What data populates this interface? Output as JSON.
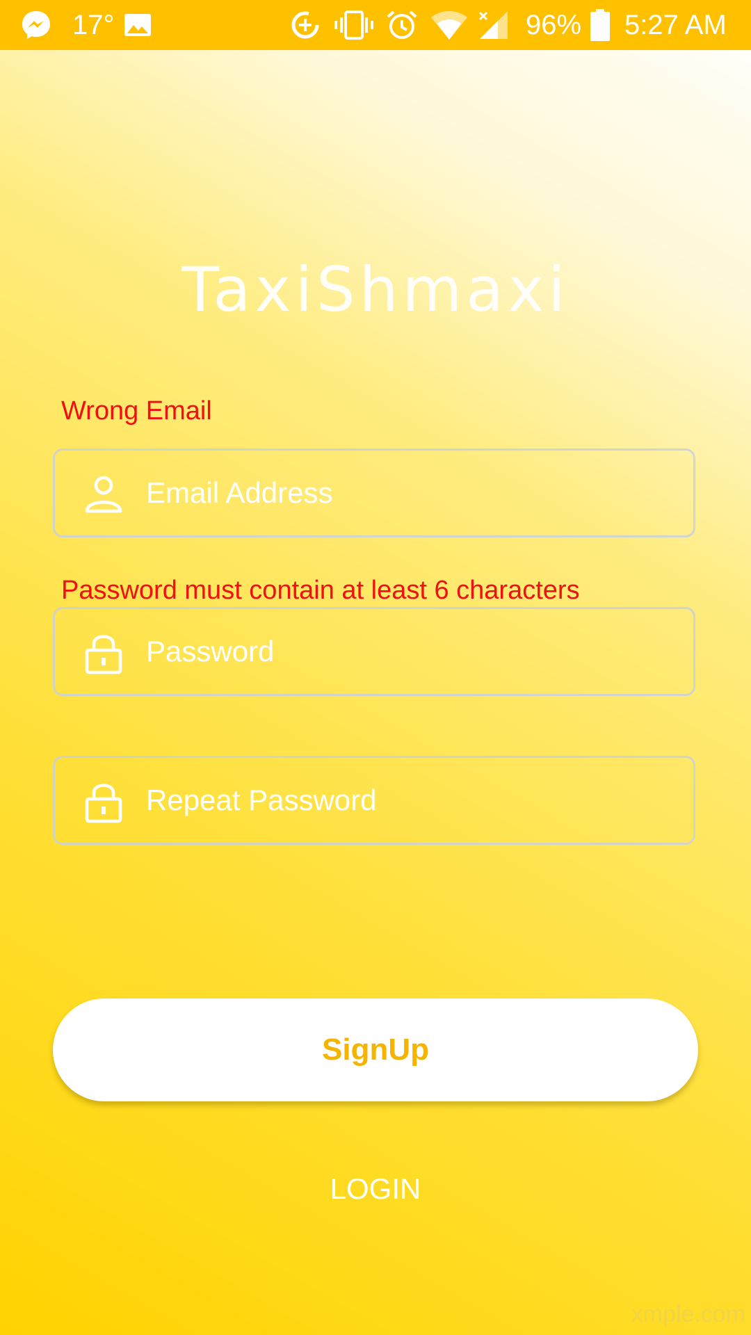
{
  "status_bar": {
    "temperature": "17°",
    "battery": "96%",
    "time": "5:27 AM",
    "icons": [
      "messenger-icon",
      "image-icon",
      "data-saver-icon",
      "vibrate-icon",
      "alarm-icon",
      "wifi-icon",
      "signal-icon",
      "battery-icon"
    ]
  },
  "app": {
    "title": "TaxiShmaxi"
  },
  "form": {
    "email_error": "Wrong Email",
    "email_placeholder": "Email Address",
    "password_error": "Password must contain at least 6 characters",
    "password_placeholder": "Password",
    "repeat_password_placeholder": "Repeat Password",
    "signup_label": "SignUp",
    "login_label": "LOGIN"
  },
  "watermark": "xmple.com",
  "colors": {
    "status_bar": "#ffc000",
    "accent": "#f5b400",
    "error": "#ee1111"
  }
}
